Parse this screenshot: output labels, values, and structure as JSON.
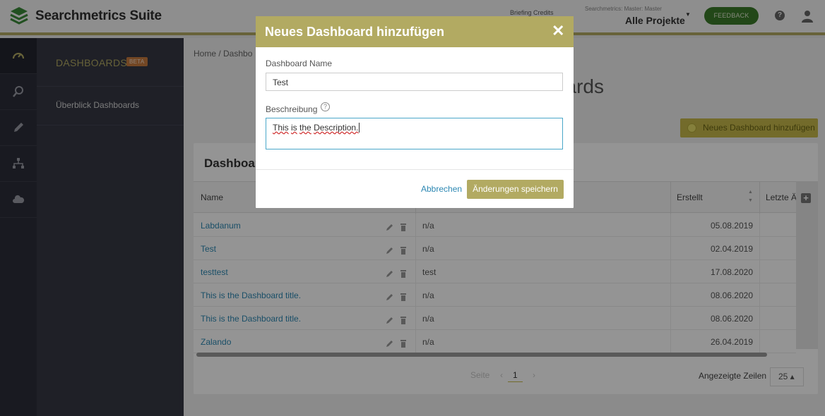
{
  "app": {
    "name": "Searchmetrics Suite"
  },
  "header": {
    "briefing_credits": "Briefing Credits",
    "project_small": "Searchmetrics: Master: Master",
    "project_main": "Alle Projekte",
    "feedback_label": "FEEDBACK",
    "help_label": "?"
  },
  "sidebar": {
    "title": "DASHBOARDS",
    "badge": "BETA",
    "items": [
      {
        "label": "Überblick Dashboards"
      }
    ]
  },
  "main": {
    "breadcrumb": "Home  /  Dashbo",
    "page_title": "ards",
    "add_button_label": "Neues Dashboard hinzufügen",
    "card_title": "Dashboar",
    "columns": {
      "name": "Name",
      "created": "Erstellt",
      "last": "Letzte Ä"
    },
    "rows": [
      {
        "name": "Labdanum",
        "description": "n/a",
        "created": "05.08.2019"
      },
      {
        "name": "Test",
        "description": "n/a",
        "created": "02.04.2019"
      },
      {
        "name": "testtest",
        "description": "test",
        "created": "17.08.2020"
      },
      {
        "name": "This is the Dashboard title.",
        "description": "n/a",
        "created": "08.06.2020"
      },
      {
        "name": "This is the Dashboard title.",
        "description": "n/a",
        "created": "08.06.2020"
      },
      {
        "name": "Zalando",
        "description": "n/a",
        "created": "26.04.2019"
      }
    ],
    "pagination": {
      "label": "Seite",
      "prev": "‹",
      "page": "1",
      "next": "›"
    },
    "rows_per_page_label": "Angezeigte Zeilen",
    "rows_per_page_value": "25 ▴"
  },
  "modal": {
    "title": "Neues Dashboard hinzufügen",
    "close": "✕",
    "name_label": "Dashboard Name",
    "name_value": "Test",
    "description_label": "Beschreibung",
    "info": "?",
    "description_words": [
      "This",
      "is",
      "the",
      "Description."
    ],
    "cancel_label": "Abbrechen",
    "save_label": "Änderungen speichern"
  },
  "colors": {
    "accent": "#b2aa62",
    "feedback": "#3b7a2a",
    "link": "#2d88b3",
    "sidebar_dark": "#2b2d39"
  },
  "icons": [
    "logo-icon",
    "speedometer-icon",
    "search-icon",
    "pencil-icon",
    "sitemap-icon",
    "cloud-icon",
    "help-icon",
    "user-icon",
    "edit-icon",
    "trash-icon",
    "close-icon",
    "info-icon",
    "plus-icon"
  ]
}
